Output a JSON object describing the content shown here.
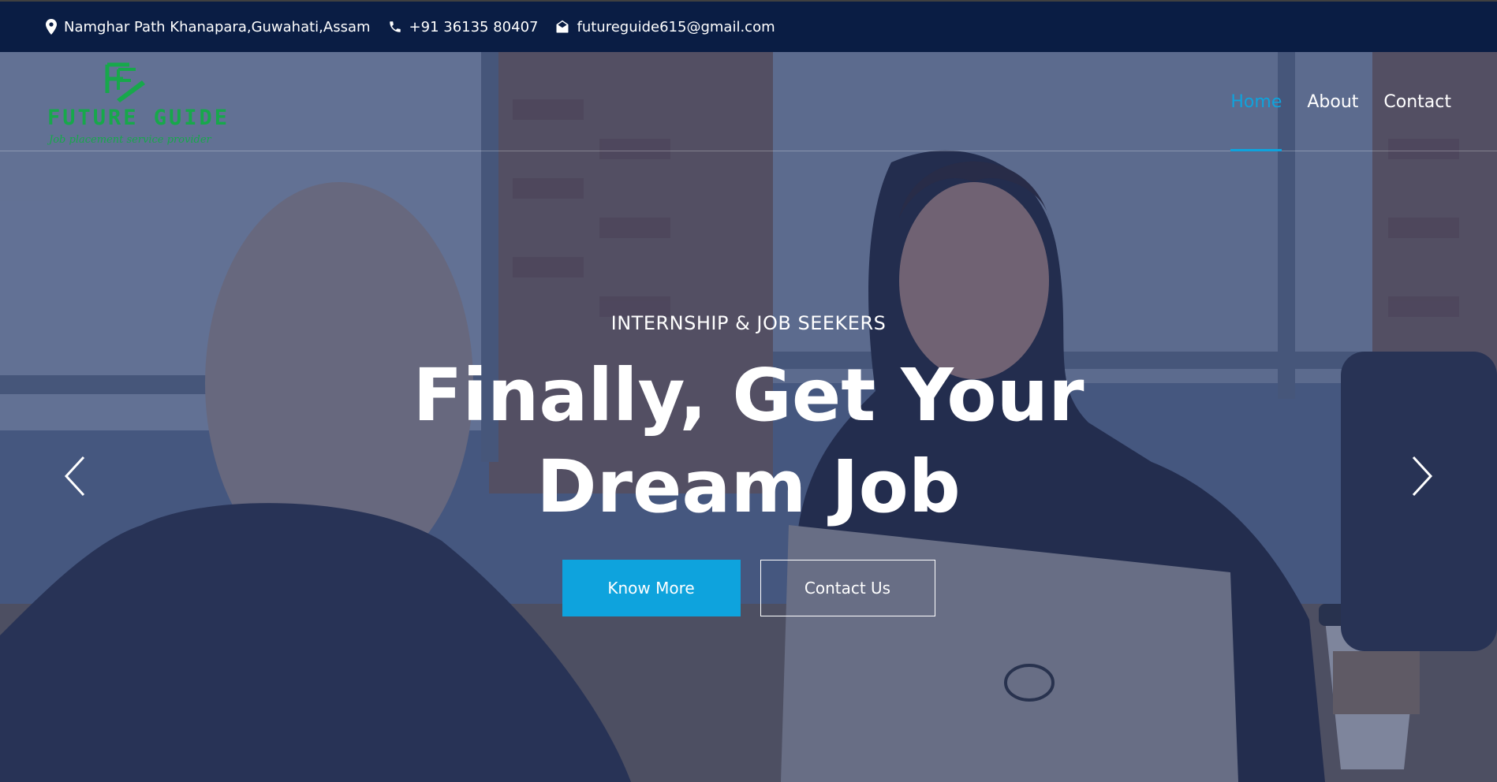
{
  "topbar": {
    "address": "Namghar Path Khanapara,Guwahati,Assam",
    "phone": "+91 36135 80407",
    "email": "futureguide615@gmail.com"
  },
  "logo": {
    "name": "FUTURE GUIDE",
    "tagline": "Job placement service provider",
    "color": "#17a84b"
  },
  "nav": {
    "items": [
      {
        "label": "Home",
        "active": true
      },
      {
        "label": "About",
        "active": false
      },
      {
        "label": "Contact",
        "active": false
      }
    ],
    "active_color": "#0ea3dd"
  },
  "hero": {
    "subtitle": "INTERNSHIP & JOB SEEKERS",
    "headline_line1": "Finally, Get Your",
    "headline_line2": "Dream Job",
    "primary_button": "Know More",
    "secondary_button": "Contact Us"
  },
  "carousel": {
    "prev_icon": "chevron-left-icon",
    "next_icon": "chevron-right-icon"
  },
  "colors": {
    "topbar_bg": "#0a1d44",
    "accent": "#0ea3dd"
  }
}
